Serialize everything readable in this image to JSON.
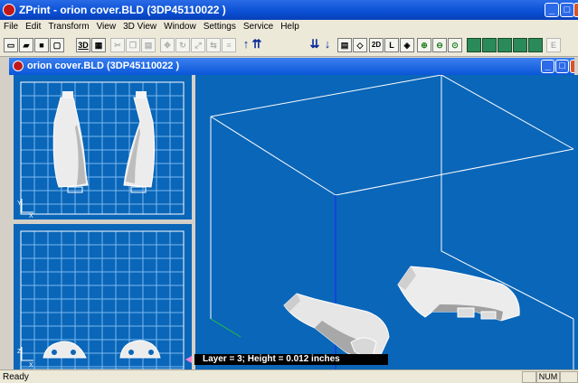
{
  "app": {
    "title": "ZPrint - orion cover.BLD (3DP45110022 )"
  },
  "menu": [
    "File",
    "Edit",
    "Transform",
    "View",
    "3D View",
    "Window",
    "Settings",
    "Service",
    "Help"
  ],
  "toolbar": {
    "layer_value": "3",
    "mode_2d": "2D",
    "mode_l": "L",
    "e_label": "E",
    "label_3d": "3D"
  },
  "child_window": {
    "title": "orion cover.BLD (3DP45110022 )"
  },
  "views": {
    "top_axis": {
      "y": "Y",
      "x": "X"
    },
    "front_axis": {
      "y": "Z",
      "x": "X"
    }
  },
  "layer_info": "Layer = 3; Height = 0.012 inches",
  "status": {
    "message": "Ready",
    "num": "NUM"
  },
  "colors": {
    "viewport": "#0a66b8",
    "grid": "#7ab8f0",
    "titlebar": "#0a4fd4",
    "close": "#d8542c"
  }
}
